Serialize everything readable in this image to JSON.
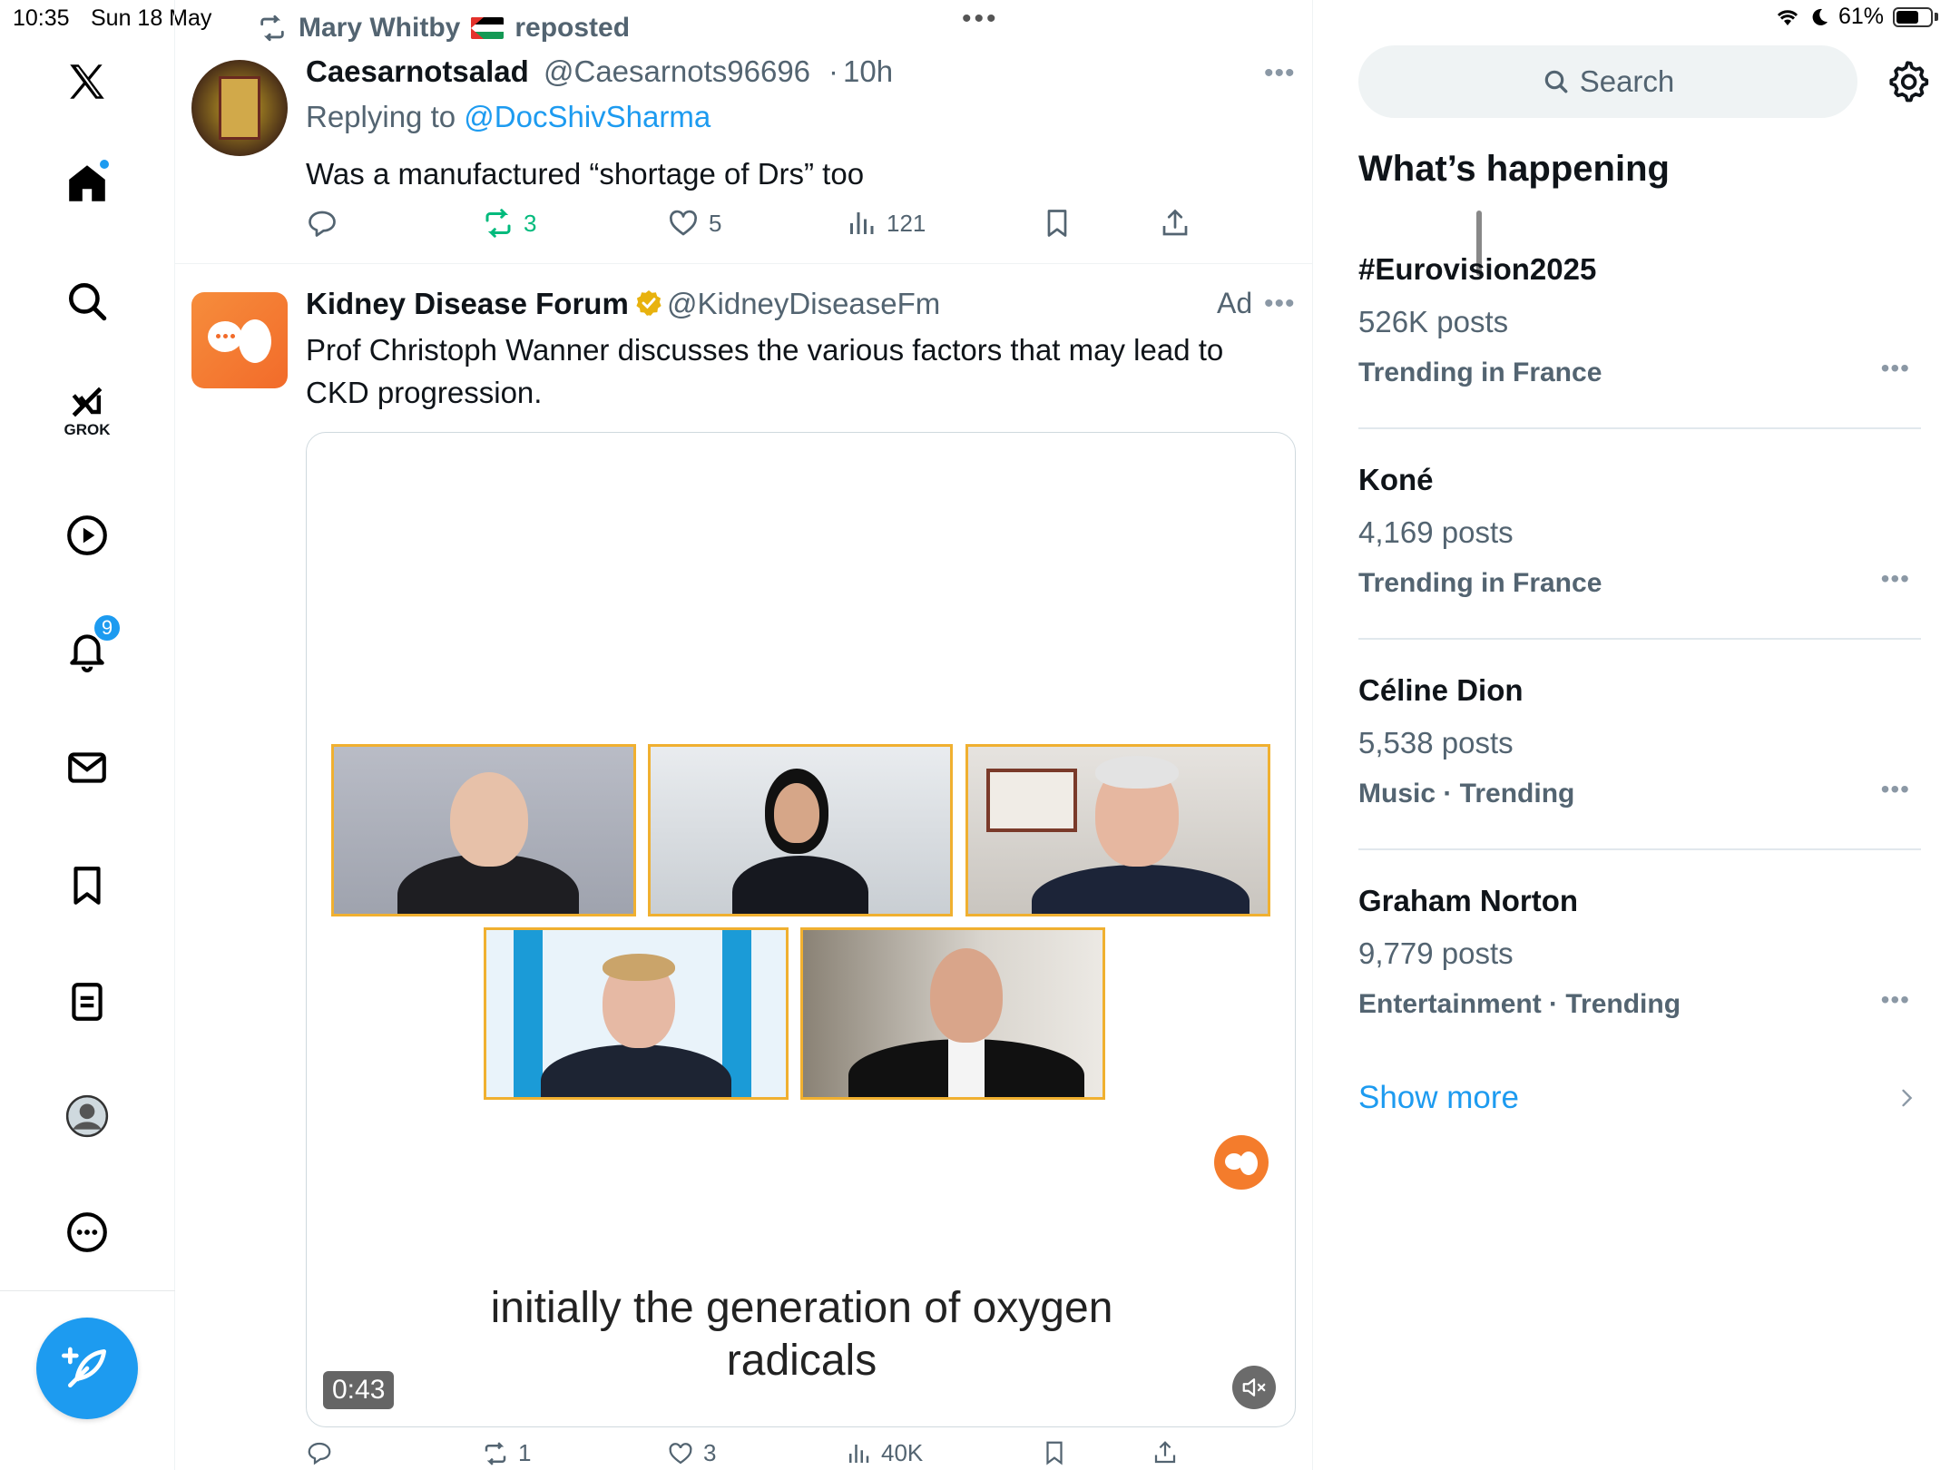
{
  "status_bar": {
    "time": "10:35",
    "date": "Sun 18 May",
    "battery": "61%",
    "battery_level": 0.61
  },
  "nav": {
    "grok_label": "GROK",
    "notifications_badge": "9"
  },
  "feed": {
    "repost_banner": {
      "user": "Mary Whitby",
      "flag": "palestine-flag",
      "label": "reposted"
    },
    "post1": {
      "name": "Caesarnotsalad",
      "handle": "@Caesarnots96696",
      "sep": "·",
      "time": "10h",
      "replying_prefix": "Replying to",
      "replying_to": "@DocShivSharma",
      "text": "Was a manufactured “shortage of Drs” too",
      "retweets": "3",
      "likes": "5",
      "views": "121"
    },
    "post2": {
      "name": "Kidney Disease Forum",
      "handle": "@KidneyDiseaseFm",
      "ad_label": "Ad",
      "text_line1": "Prof Christoph Wanner discusses the various factors that may lead to",
      "text_line2": "CKD progression.",
      "video": {
        "caption_line1": "initially the generation of oxygen",
        "caption_line2": "radicals",
        "duration": "0:43"
      },
      "retweets": "1",
      "likes": "3",
      "views": "40K"
    }
  },
  "sidebar": {
    "search_placeholder": "Search",
    "section_title": "What’s happening",
    "trends": [
      {
        "name": "#Eurovision2025",
        "count": "526K posts",
        "meta": "Trending in France"
      },
      {
        "name": "Koné",
        "count": "4,169 posts",
        "meta": "Trending in France"
      },
      {
        "name": "Céline Dion",
        "count": "5,538 posts",
        "meta": "Music · Trending"
      },
      {
        "name": "Graham Norton",
        "count": "9,779 posts",
        "meta": "Entertainment · Trending"
      }
    ],
    "show_more": "Show more"
  },
  "colors": {
    "accent": "#1d9bf0",
    "repost_active": "#00ba7c",
    "ad_brand": "#f47c2c",
    "tile_border": "#f0b030"
  }
}
